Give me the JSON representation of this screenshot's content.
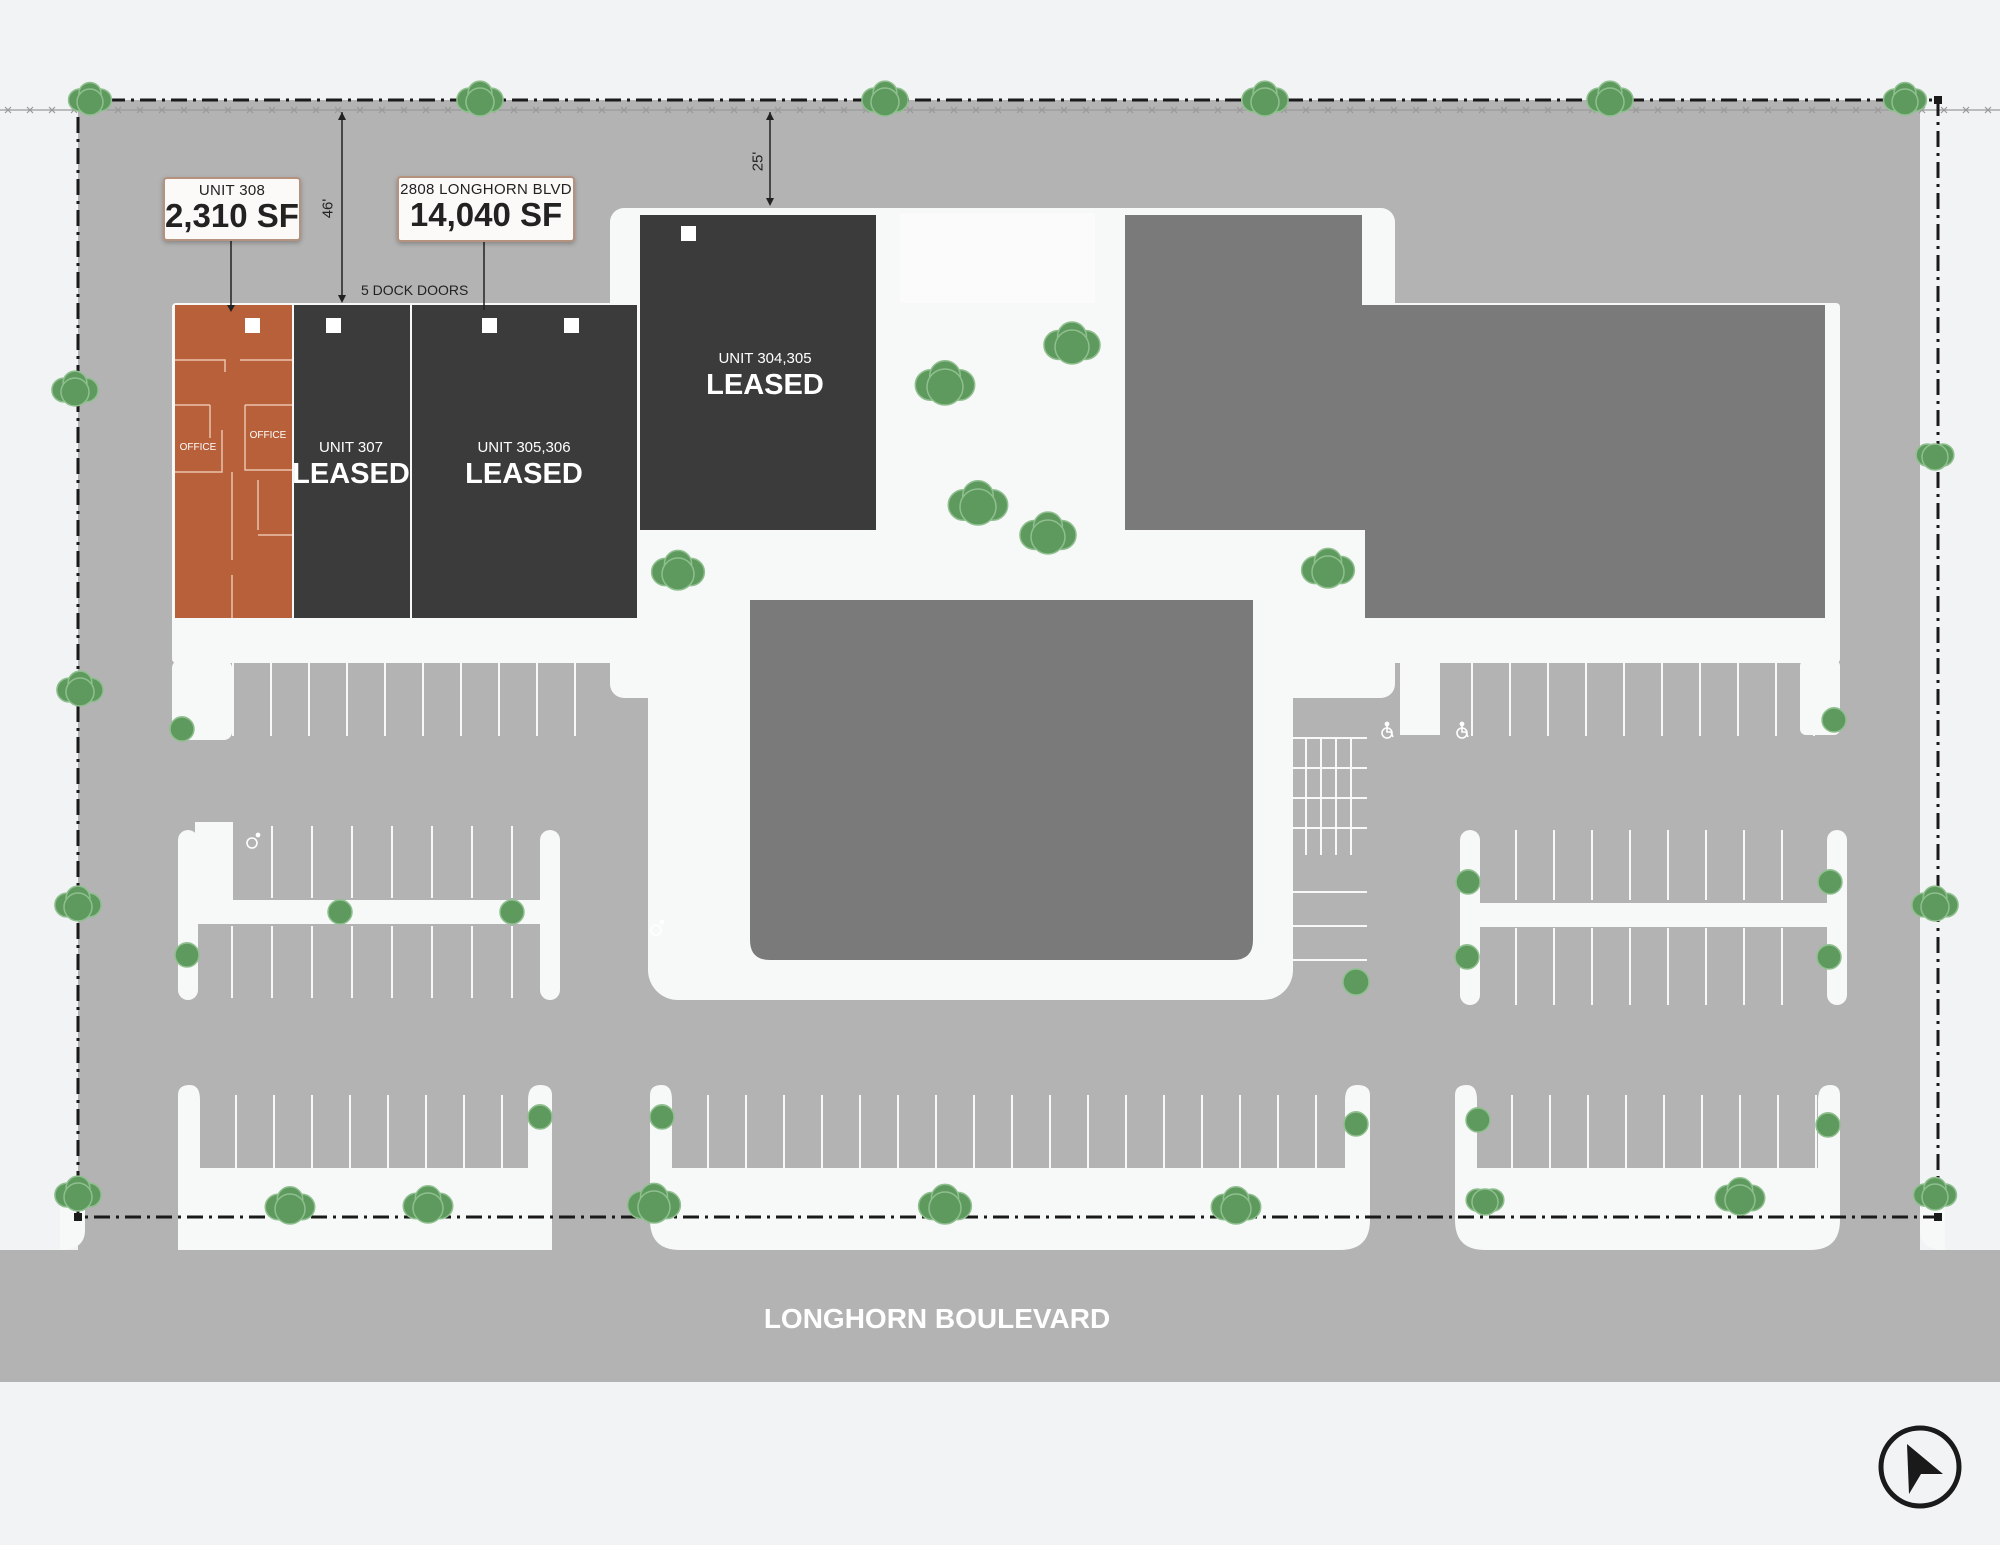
{
  "callouts": {
    "unit308": {
      "unit": "UNIT 308",
      "area": "2,310 SF"
    },
    "building": {
      "address": "2808 LONGHORN BLVD",
      "area": "14,040 SF"
    }
  },
  "dimensions": {
    "setback_left": "46'",
    "setback_top": "25'"
  },
  "dock_doors": "5 DOCK DOORS",
  "units": [
    {
      "name": "UNIT 307",
      "status": "LEASED"
    },
    {
      "name": "UNIT 305,306",
      "status": "LEASED"
    },
    {
      "name": "UNIT 304,305",
      "status": "LEASED"
    }
  ],
  "rooms": {
    "office_left": "OFFICE",
    "office_right": "OFFICE"
  },
  "road": {
    "name": "LONGHORN BOULEVARD"
  },
  "colors": {
    "available_unit": "#b8603a",
    "leased_unit": "#3b3b3b",
    "other_building": "#7a7a7a",
    "pavement": "#b3b3b3",
    "sidewalk": "#f7f8f8",
    "tree": "#5e9a5e",
    "background": "#f2f3f5"
  },
  "icons": [
    "accessible-parking-icon",
    "north-arrow-icon",
    "tree-icon"
  ]
}
